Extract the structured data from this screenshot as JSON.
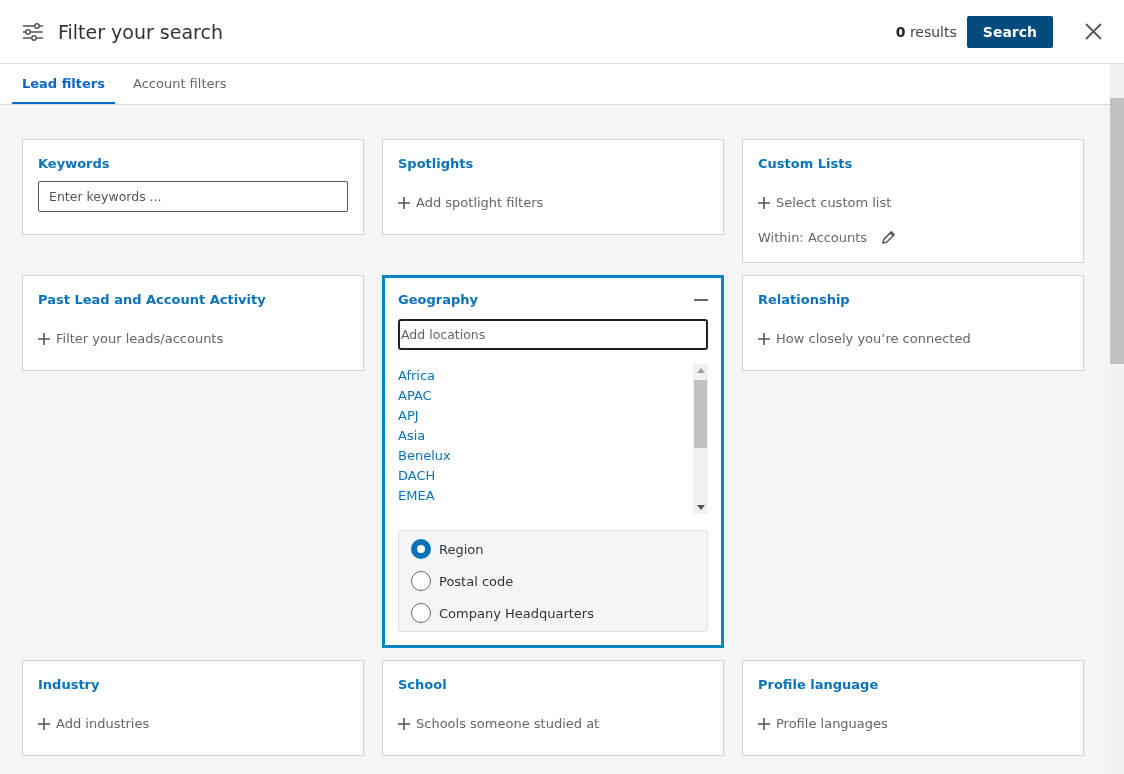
{
  "header": {
    "title": "Filter your search",
    "results_count": "0",
    "results_label": "results",
    "search_button": "Search"
  },
  "tabs": [
    {
      "label": "Lead filters",
      "selected": true
    },
    {
      "label": "Account filters",
      "selected": false
    }
  ],
  "cards": [
    {
      "kind": "field",
      "title": "Keywords",
      "placeholder": "Enter keywords ..."
    },
    {
      "kind": "add",
      "title": "Spotlights",
      "action": "Add spotlight filters"
    },
    {
      "kind": "custom",
      "title": "Custom Lists",
      "action": "Select custom list",
      "within": "Within: Accounts"
    },
    {
      "kind": "add",
      "title": "Past Lead and Account Activity",
      "action": "Filter your leads/accounts"
    },
    {
      "kind": "geography",
      "title": "Geography",
      "expanded": true,
      "placeholder": "Add locations",
      "locations": [
        "Africa",
        "APAC",
        "APJ",
        "Asia",
        "Benelux",
        "DACH",
        "EMEA"
      ],
      "options": [
        {
          "label": "Region",
          "selected": true
        },
        {
          "label": "Postal code",
          "selected": false
        },
        {
          "label": "Company Headquarters",
          "selected": false
        }
      ]
    },
    {
      "kind": "add",
      "title": "Relationship",
      "action": "How closely you’re connected"
    },
    {
      "kind": "add",
      "title": "Industry",
      "action": "Add industries"
    },
    {
      "kind": "add",
      "title": "School",
      "action": "Schools someone studied at"
    },
    {
      "kind": "add",
      "title": "Profile language",
      "action": "Profile languages"
    }
  ]
}
